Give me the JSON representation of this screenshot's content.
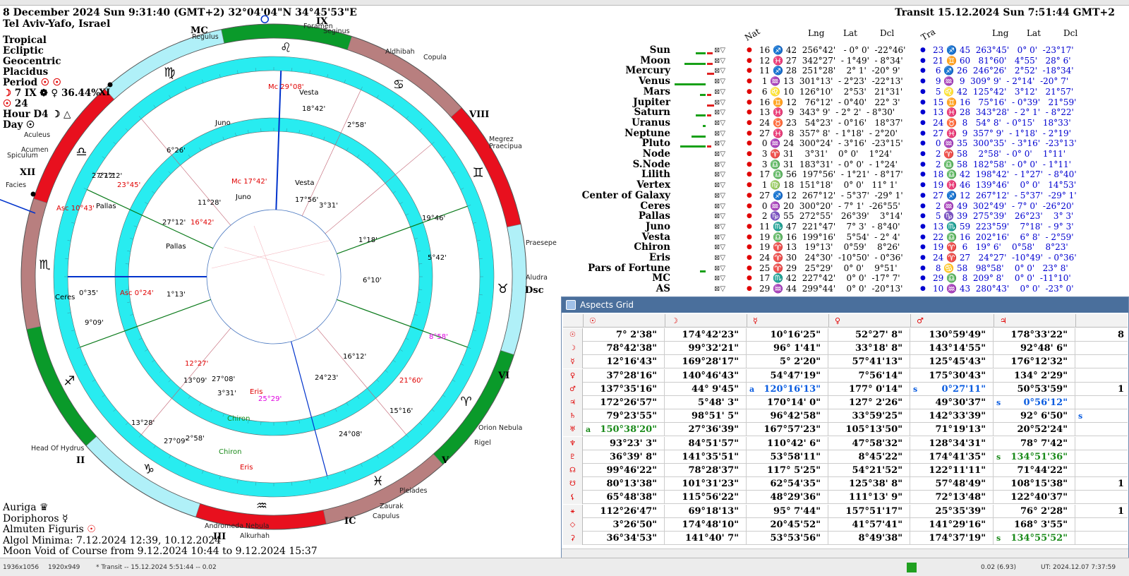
{
  "header": {
    "datetime": "8 December 2024  Sun   9:31:40 (GMT+2) 32°04'04\"N  34°45'53\"E",
    "place": "Tel Aviv-Yafo, Israel",
    "transit": "Transit 15.12.2024  Sun  7:51:44 GMT+2"
  },
  "settings": {
    "lines": [
      "Tropical",
      "Ecliptic",
      "Geocentric",
      "Placidus"
    ],
    "period": "Period",
    "moon_line": "7 IX",
    "moon_pct": "36.44%",
    "num": "24",
    "hour": "Hour D4",
    "day": "Day"
  },
  "wheel": {
    "house_labels": [
      "MC",
      "IX",
      "VIII",
      "Dsc",
      "VI",
      "V",
      "IC",
      "III",
      "II",
      "XII",
      "XI"
    ],
    "stars": [
      "Regulus",
      "Foramen",
      "Seginus",
      "Aldhibah",
      "Copula",
      "Megrez",
      "Praecipua",
      "Praesepe",
      "Aludra",
      "Orion Nebula",
      "Rigel",
      "Pleiades",
      "Zaurak",
      "Capulus",
      "Andromeda Nebula",
      "Alkurhah",
      "Head Of Hydrus",
      "Facies",
      "Acumen",
      "Spiculum",
      "Aculeus"
    ],
    "outer_points": [
      {
        "label": "Mc",
        "deg": "29°08'",
        "color": "#e00000"
      },
      {
        "label": "Vesta",
        "deg": "",
        "color": "#000"
      },
      {
        "label": "",
        "deg": "18°42'",
        "color": "#000"
      },
      {
        "label": "",
        "deg": "2°58'",
        "color": "#000"
      },
      {
        "label": "",
        "deg": "19°46'",
        "color": "#000"
      },
      {
        "label": "",
        "deg": "5°42'",
        "color": "#000"
      },
      {
        "label": "",
        "deg": "8°58'",
        "color": "#e000e0"
      },
      {
        "label": "",
        "deg": "21°60'",
        "color": "#e00000"
      },
      {
        "label": "",
        "deg": "15°16'",
        "color": "#000"
      },
      {
        "label": "",
        "deg": "24°08'",
        "color": "#000"
      },
      {
        "label": "Eris",
        "deg": "",
        "color": "#e00000"
      },
      {
        "label": "Chiron",
        "deg": "",
        "color": "#1a8a1a"
      },
      {
        "label": "",
        "deg": "2°58'",
        "color": "#000"
      },
      {
        "label": "",
        "deg": "27°09'",
        "color": "#000"
      },
      {
        "label": "",
        "deg": "13°28'",
        "color": "#000"
      },
      {
        "label": "",
        "deg": "9°09'",
        "color": "#000"
      },
      {
        "label": "Ceres",
        "deg": "",
        "color": "#000"
      },
      {
        "label": "",
        "deg": "0°35'",
        "color": "#000"
      },
      {
        "label": "Asc",
        "deg": "10°43'",
        "color": "#e00000"
      },
      {
        "label": "Pallas",
        "deg": "",
        "color": "#000"
      },
      {
        "label": "",
        "deg": "27°12'",
        "color": "#000"
      },
      {
        "label": "",
        "deg": "6°26'",
        "color": "#000"
      },
      {
        "label": "Juno",
        "deg": "",
        "color": "#000"
      }
    ],
    "inner_points": [
      {
        "label": "Mc",
        "deg": "17°42'",
        "color": "#e00000"
      },
      {
        "label": "Vesta",
        "deg": "",
        "color": "#000"
      },
      {
        "label": "Juno",
        "deg": "",
        "color": "#000"
      },
      {
        "label": "",
        "deg": "17°56'",
        "color": "#000"
      },
      {
        "label": "",
        "deg": "3°31'",
        "color": "#000"
      },
      {
        "label": "",
        "deg": "1°18'",
        "color": "#000"
      },
      {
        "label": "",
        "deg": "6°10'",
        "color": "#000"
      },
      {
        "label": "",
        "deg": "16°12'",
        "color": "#000"
      },
      {
        "label": "",
        "deg": "24°23'",
        "color": "#000"
      },
      {
        "label": "",
        "deg": "25°29'",
        "color": "#e000e0"
      },
      {
        "label": "Eris",
        "deg": "",
        "color": "#e00000"
      },
      {
        "label": "Chiron",
        "deg": "",
        "color": "#1a8a1a"
      },
      {
        "label": "",
        "deg": "3°31'",
        "color": "#000"
      },
      {
        "label": "",
        "deg": "27°08'",
        "color": "#000"
      },
      {
        "label": "",
        "deg": "13°09'",
        "color": "#000"
      },
      {
        "label": "",
        "deg": "12°27'",
        "color": "#e00000"
      },
      {
        "label": "",
        "deg": "1°13'",
        "color": "#000"
      },
      {
        "label": "Asc",
        "deg": "0°24'",
        "color": "#e00000"
      },
      {
        "label": "Pallas",
        "deg": "",
        "color": "#000"
      },
      {
        "label": "",
        "deg": "27°12'",
        "color": "#000"
      },
      {
        "label": "",
        "deg": "16°42'",
        "color": "#e00000"
      },
      {
        "label": "",
        "deg": "11°28'",
        "color": "#000"
      },
      {
        "label": "",
        "deg": "23°45'",
        "color": "#e00000"
      },
      {
        "label": "",
        "deg": "27°12'",
        "color": "#000"
      }
    ]
  },
  "planets": {
    "headers": {
      "nat": "Nat",
      "lng": "Lng",
      "lat": "Lat",
      "dcl": "Dcl",
      "tra": "Tra",
      "lng2": "Lng",
      "lat2": "Lat",
      "dcl2": "Dcl"
    },
    "rows": [
      {
        "name": "Sun",
        "nat": "16 ♐ 42  256°42'   - 0° 0'  -22°46'",
        "tra": "23 ♐ 45  263°45'   0° 0'  -23°17'",
        "bar": 14,
        "bar2": 8
      },
      {
        "name": "Moon",
        "nat": "12 ♓ 27  342°27'  - 1°49'  - 8°34'",
        "tra": "21 ♊ 60   81°60'   4°55'   28° 6'",
        "bar": 30,
        "bar2": 8
      },
      {
        "name": "Mercury",
        "nat": "11 ♐ 28  251°28'    2° 1'  -20° 9'",
        "tra": " 6 ♐ 26  246°26'   2°52'  -18°34'",
        "bar": 0,
        "bar2": 10
      },
      {
        "name": "Venus",
        "nat": " 1 ♒ 13  301°13'  - 2°23'  -22°13'",
        "tra": " 9 ♒  9  309° 9'  - 2°14'  -20° 7'",
        "bar": 44,
        "bar2": 0
      },
      {
        "name": "Mars",
        "nat": " 6 ♌ 10  126°10'    2°53'   21°31'",
        "tra": " 5 ♌ 42  125°42'   3°12'   21°57'",
        "bar": 8,
        "bar2": 6
      },
      {
        "name": "Jupiter",
        "nat": "16 ♊ 12   76°12'  - 0°40'   22° 3'",
        "tra": "15 ♊ 16   75°16'  - 0°39'   21°59'",
        "bar": 0,
        "bar2": 10
      },
      {
        "name": "Saturn",
        "nat": "13 ♓  9  343° 9'  - 2° 2'  - 8°30'",
        "tra": "13 ♓ 28  343°28'  - 2° 1'  - 8°22'",
        "bar": 14,
        "bar2": 6
      },
      {
        "name": "Uranus",
        "nat": "24 ♉ 23   54°23'  - 0°16'   18°37'",
        "tra": "24 ♉  8   54° 8'  - 0°15'   18°33'",
        "bar": 4,
        "bar2": 0
      },
      {
        "name": "Neptune",
        "nat": "27 ♓  8  357° 8'  - 1°18'  - 2°20'",
        "tra": "27 ♓  9  357° 9'  - 1°18'  - 2°19'",
        "bar": 20,
        "bar2": 0
      },
      {
        "name": "Pluto",
        "nat": " 0 ♒ 24  300°24'  - 3°16'  -23°15'",
        "tra": " 0 ♒ 35  300°35'  - 3°16'  -23°13'",
        "bar": 36,
        "bar2": 6
      },
      {
        "name": "Node",
        "nat": " 3 ♈ 31    3°31'    0° 0'    1°24'",
        "tra": " 2 ♈ 58    2°58'  - 0° 0'    1°11'",
        "bar": 0,
        "bar2": 0
      },
      {
        "name": "S.Node",
        "nat": " 3 ♎ 31  183°31'  - 0° 0'  - 1°24'",
        "tra": " 2 ♎ 58  182°58'  - 0° 0'  - 1°11'",
        "bar": 0,
        "bar2": 0
      },
      {
        "name": "Lilith",
        "nat": "17 ♎ 56  197°56'  - 1°21'  - 8°17'",
        "tra": "18 ♎ 42  198°42'  - 1°27'  - 8°40'",
        "bar": 0,
        "bar2": 0
      },
      {
        "name": "Vertex",
        "nat": " 1 ♍ 18  151°18'    0° 0'   11° 1'",
        "tra": "19 ♓ 46  139°46'    0° 0'   14°53'",
        "bar": 0,
        "bar2": 0
      },
      {
        "name": "Center of Galaxy",
        "nat": "27 ♐ 12  267°12'  - 5°37'  -29° 1'",
        "tra": "27 ♐ 12  267°12'  - 5°37'  -29° 1'",
        "bar": 0,
        "bar2": 0
      },
      {
        "name": "Ceres",
        "nat": " 0 ♒ 20  300°20'  - 7° 1'  -26°55'",
        "tra": " 2 ♒ 49  302°49'  - 7° 0'  -26°20'",
        "bar": 0,
        "bar2": 0
      },
      {
        "name": "Pallas",
        "nat": " 2 ♑ 55  272°55'   26°39'    3°14'",
        "tra": " 5 ♑ 39  275°39'   26°23'    3° 3'",
        "bar": 0,
        "bar2": 0
      },
      {
        "name": "Juno",
        "nat": "11 ♏ 47  221°47'    7° 3'  - 8°40'",
        "tra": "13 ♏ 59  223°59'    7°18'  - 9° 3'",
        "bar": 0,
        "bar2": 0
      },
      {
        "name": "Vesta",
        "nat": "19 ♎ 16  199°16'    5°54'  - 2° 4'",
        "tra": "22 ♎ 16  202°16'    6° 8'  - 2°59'",
        "bar": 0,
        "bar2": 0
      },
      {
        "name": "Chiron",
        "nat": "19 ♈ 13   19°13'    0°59'    8°26'",
        "tra": "19 ♈  6   19° 6'    0°58'    8°23'",
        "bar": 0,
        "bar2": 0
      },
      {
        "name": "Eris",
        "nat": "24 ♈ 30   24°30'  -10°50'  - 0°36'",
        "tra": "24 ♈ 27   24°27'  -10°49'  - 0°36'",
        "bar": 0,
        "bar2": 0
      },
      {
        "name": "Pars of Fortune",
        "nat": "25 ♈ 29   25°29'    0° 0'    9°51'",
        "tra": " 8 ♋ 58   98°58'    0° 0'   23° 8'",
        "bar": 8,
        "bar2": 0
      },
      {
        "name": "MC",
        "nat": "17 ♏ 42  227°42'    0° 0'  -17° 7'",
        "tra": "29 ♎  8  209° 8'    0° 0'  -11°10'",
        "bar": 0,
        "bar2": 0
      },
      {
        "name": "AS",
        "nat": "29 ♒ 44  299°44'    0° 0'  -20°13'",
        "tra": "10 ♒ 43  280°43'    0° 0'  -23° 0'",
        "bar": 0,
        "bar2": 0
      }
    ]
  },
  "aspects_grid": {
    "title": "Aspects Grid",
    "col_glyphs": [
      "☉",
      "☽",
      "☿",
      "♀",
      "♂",
      "♃",
      ""
    ],
    "row_glyphs": [
      "☉",
      "☽",
      "☿",
      "♀",
      "♂",
      "♃",
      "♄",
      "♅",
      "♆",
      "♇",
      "☊",
      "☋",
      "⚸",
      "⚹",
      "◇",
      "⚳"
    ],
    "rows": [
      [
        "7° 2'38\"",
        "174°42'23\"",
        "10°16'25\"",
        "52°27' 8\"",
        "130°59'49\"",
        "178°33'22\"",
        "8"
      ],
      [
        "78°42'38\"",
        "99°32'21\"",
        "96° 1'41\"",
        "33°18' 8\"",
        "143°14'55\"",
        "92°48' 6\"",
        ""
      ],
      [
        "12°16'43\"",
        "169°28'17\"",
        "5° 2'20\"",
        "57°41'13\"",
        "125°45'43\"",
        "176°12'32\"",
        ""
      ],
      [
        "37°28'16\"",
        "140°46'43\"",
        "54°47'19\"",
        "7°56'14\"",
        "175°30'43\"",
        "134° 2'29\"",
        ""
      ],
      [
        "137°35'16\"",
        "44° 9'45\"",
        "120°16'13\"",
        "177° 0'14\"",
        "0°27'11\"",
        "50°53'59\"",
        "1"
      ],
      [
        "172°26'57\"",
        "5°48' 3\"",
        "170°14' 0\"",
        "127° 2'26\"",
        "49°30'37\"",
        "0°56'12\"",
        ""
      ],
      [
        "79°23'55\"",
        "98°51' 5\"",
        "96°42'58\"",
        "33°59'25\"",
        "142°33'39\"",
        "92° 6'50\"",
        ""
      ],
      [
        "150°38'20\"",
        "27°36'39\"",
        "167°57'23\"",
        "105°13'50\"",
        "71°19'13\"",
        "20°52'24\"",
        ""
      ],
      [
        "93°23' 3\"",
        "84°51'57\"",
        "110°42' 6\"",
        "47°58'32\"",
        "128°34'31\"",
        "78° 7'42\"",
        ""
      ],
      [
        "36°39' 8\"",
        "141°35'51\"",
        "53°58'11\"",
        "8°45'22\"",
        "174°41'35\"",
        "134°51'36\"",
        ""
      ],
      [
        "99°46'22\"",
        "78°28'37\"",
        "117° 5'25\"",
        "54°21'52\"",
        "122°11'11\"",
        "71°44'22\"",
        ""
      ],
      [
        "80°13'38\"",
        "101°31'23\"",
        "62°54'35\"",
        "125°38' 8\"",
        "57°48'49\"",
        "108°15'38\"",
        "1"
      ],
      [
        "65°48'38\"",
        "115°56'22\"",
        "48°29'36\"",
        "111°13' 9\"",
        "72°13'48\"",
        "122°40'37\"",
        ""
      ],
      [
        "112°26'47\"",
        "69°18'13\"",
        "95° 7'44\"",
        "157°51'17\"",
        "25°35'39\"",
        "76° 2'28\"",
        "1"
      ],
      [
        "3°26'50\"",
        "174°48'10\"",
        "20°45'52\"",
        "41°57'41\"",
        "141°29'16\"",
        "168° 3'55\"",
        ""
      ],
      [
        "36°34'53\"",
        "141°40' 7\"",
        "53°53'56\"",
        "8°49'38\"",
        "174°37'19\"",
        "134°55'52\"",
        ""
      ]
    ],
    "tags": {
      "r4c2": "a",
      "r4c4": "s",
      "r5c5": "s",
      "r6c6": "s",
      "r7c0": "a",
      "r9c5": "s",
      "r15c5": "s"
    }
  },
  "bottom_info": {
    "lines": [
      "Auriga",
      "Doriphoros",
      "Almuten Figuris",
      "Algol Minima: 7.12.2024 12:39,  10.12.2024",
      "Moon Void of Course from 9.12.2024 10:44 to 9.12.2024 15:37"
    ]
  },
  "status_bar": {
    "items": [
      "1936x1056",
      "1920x949",
      "* Transit -- 15.12.2024  5:51:44 -- 0.02",
      "0.02 (6.93)",
      "UT: 2024.12.07  7:37:59"
    ]
  }
}
